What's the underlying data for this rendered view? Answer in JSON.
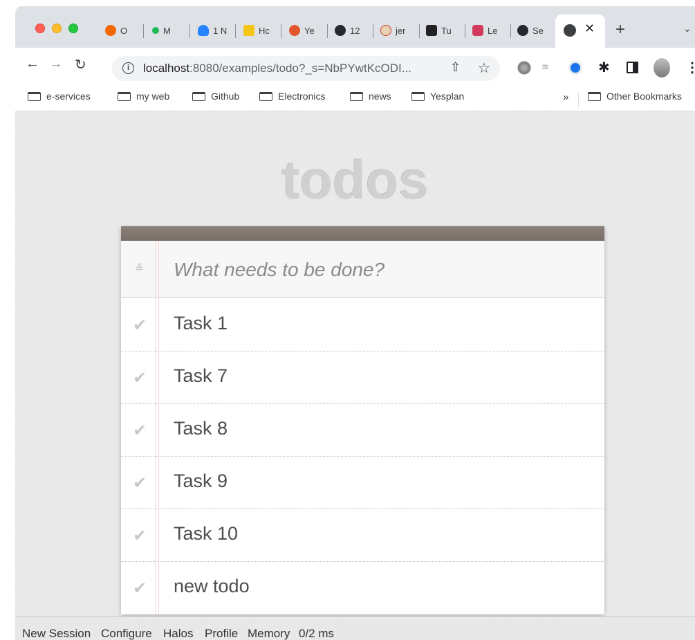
{
  "tabs": [
    {
      "label": "O",
      "icon": "grafana-icon",
      "color": "#f46800"
    },
    {
      "label": "M",
      "icon": "green-dot-icon",
      "color": "#1db954"
    },
    {
      "label": "1 N",
      "icon": "sourcetree-icon",
      "color": "#2684ff"
    },
    {
      "label": "Hc",
      "icon": "yellow-app-icon",
      "color": "#f5c518"
    },
    {
      "label": "Ye",
      "icon": "yesplan-icon",
      "color": "#e4572e"
    },
    {
      "label": "12",
      "icon": "github-icon",
      "color": "#24292f"
    },
    {
      "label": "jer",
      "icon": "jenkins-icon",
      "color": "#d33833"
    },
    {
      "label": "Tu",
      "icon": "tutorial-icon",
      "color": "#222222"
    },
    {
      "label": "Le",
      "icon": "gem-icon",
      "color": "#d13a5a"
    },
    {
      "label": "Se",
      "icon": "github-icon",
      "color": "#24292f"
    }
  ],
  "toolbar": {
    "url_host": "localhost",
    "url_rest": ":8080/examples/todo?_s=NbPYwtKcODI..."
  },
  "bookmarks": {
    "items": [
      "e-services",
      "my web",
      "Github",
      "Electronics",
      "news",
      "Yesplan"
    ],
    "more": "»",
    "other": "Other Bookmarks"
  },
  "app": {
    "title": "todos",
    "placeholder": "What needs to be done?",
    "todos": [
      "Task 1",
      "Task 7",
      "Task 8",
      "Task 9",
      "Task 10",
      "new todo"
    ]
  },
  "devbar": {
    "links": [
      "New Session",
      "Configure",
      "Halos",
      "Profile",
      "Memory",
      "0/2 ms"
    ]
  }
}
